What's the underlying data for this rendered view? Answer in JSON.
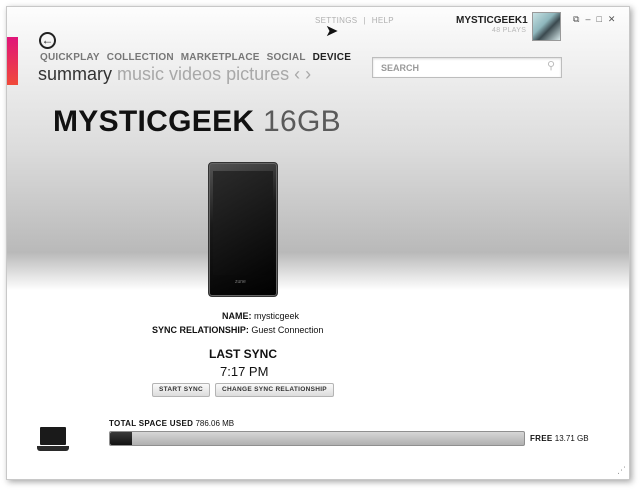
{
  "header": {
    "settings_label": "SETTINGS",
    "separator": "|",
    "help_label": "HELP",
    "profile_name": "MYSTICGEEK1",
    "profile_plays": "48 PLAYS"
  },
  "window_controls": {
    "compact": "⧉",
    "minimize": "–",
    "maximize": "□",
    "close": "✕"
  },
  "nav": {
    "back_glyph": "←",
    "main": [
      "QUICKPLAY",
      "COLLECTION",
      "MARKETPLACE",
      "SOCIAL",
      "DEVICE"
    ],
    "main_active": "DEVICE",
    "sub": [
      "summary",
      "music",
      "videos",
      "pictures"
    ],
    "sub_active": "summary",
    "prev_glyph": "‹",
    "next_glyph": "›"
  },
  "search": {
    "placeholder": "SEARCH",
    "icon": "search-icon"
  },
  "device": {
    "name": "MYSTICGEEK",
    "capacity": "16GB",
    "logo": "zune",
    "name_label": "NAME:",
    "name_value": "mysticgeek",
    "sync_label": "SYNC RELATIONSHIP:",
    "sync_value": "Guest Connection",
    "last_sync_title": "LAST SYNC",
    "last_sync_time": "7:17 PM",
    "start_sync_label": "START SYNC",
    "change_sync_label": "CHANGE SYNC RELATIONSHIP"
  },
  "storage": {
    "used_label": "TOTAL SPACE USED",
    "used_value": "786.06 MB",
    "free_label": "FREE",
    "free_value": "13.71 GB",
    "used_fraction": 0.053
  },
  "colors": {
    "brand_gradient_top": "#e0157a",
    "brand_gradient_bottom": "#f04a3a"
  }
}
